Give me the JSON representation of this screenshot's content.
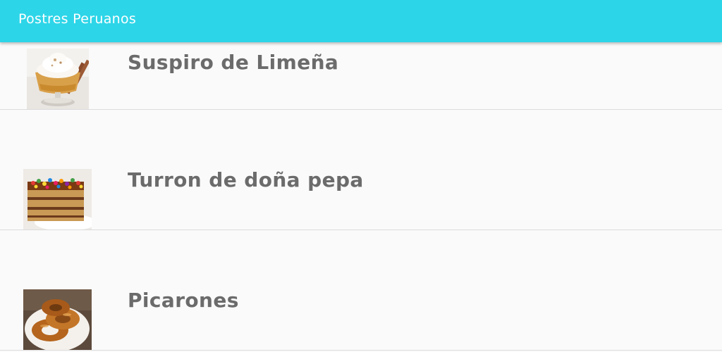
{
  "appbar": {
    "title": "Postres Peruanos",
    "color": "#2dd5e8"
  },
  "list": {
    "items": [
      {
        "label": "Suspiro de Limeña",
        "image": "suspiro-dessert-glass"
      },
      {
        "label": "Turron de doña pepa",
        "image": "turron-cake-slice"
      },
      {
        "label": "Picarones",
        "image": "picarones-plate"
      }
    ]
  }
}
